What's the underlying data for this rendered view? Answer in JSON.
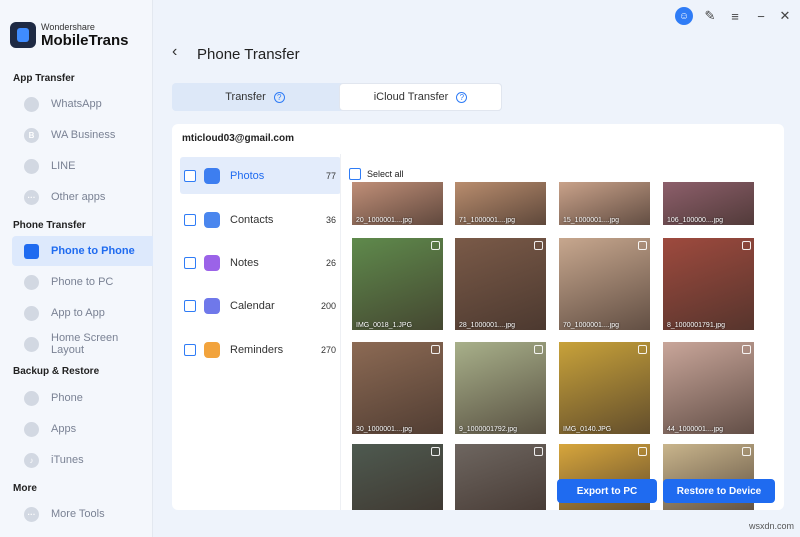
{
  "app": {
    "brand_small": "Wondershare",
    "brand_name": "MobileTrans"
  },
  "sidebar": {
    "sections": [
      {
        "title": "App Transfer",
        "items": [
          {
            "label": "WhatsApp",
            "icon": "whatsapp-icon"
          },
          {
            "label": "WA Business",
            "icon": "wa-business-icon"
          },
          {
            "label": "LINE",
            "icon": "line-icon"
          },
          {
            "label": "Other apps",
            "icon": "other-apps-icon"
          }
        ]
      },
      {
        "title": "Phone Transfer",
        "items": [
          {
            "label": "Phone to Phone",
            "icon": "phone-to-phone-icon",
            "active": true
          },
          {
            "label": "Phone to PC",
            "icon": "phone-to-pc-icon"
          },
          {
            "label": "App to App",
            "icon": "app-to-app-icon"
          },
          {
            "label": "Home Screen Layout",
            "icon": "home-screen-icon"
          }
        ]
      },
      {
        "title": "Backup & Restore",
        "items": [
          {
            "label": "Phone",
            "icon": "phone-icon"
          },
          {
            "label": "Apps",
            "icon": "apps-icon"
          },
          {
            "label": "iTunes",
            "icon": "itunes-icon"
          }
        ]
      },
      {
        "title": "More",
        "items": [
          {
            "label": "More Tools",
            "icon": "more-tools-icon"
          }
        ]
      }
    ]
  },
  "window": {
    "icons": [
      "account-icon",
      "feedback-icon",
      "menu-icon",
      "close-icon"
    ]
  },
  "header": {
    "back_icon": "back-arrow-icon",
    "title": "Phone Transfer"
  },
  "tabs": [
    {
      "label": "Transfer",
      "selected": false
    },
    {
      "label": "iCloud Transfer",
      "selected": true
    }
  ],
  "panel": {
    "account": "mticloud03@gmail.com",
    "categories": [
      {
        "label": "Photos",
        "count": "77",
        "color": "#3d7ef0",
        "active": true
      },
      {
        "label": "Contacts",
        "count": "36",
        "color": "#4a86ee"
      },
      {
        "label": "Notes",
        "count": "26",
        "color": "#9b63e8"
      },
      {
        "label": "Calendar",
        "count": "200",
        "color": "#6f78ea"
      },
      {
        "label": "Reminders",
        "count": "270",
        "color": "#f2a33c"
      }
    ],
    "select_all": "Select all",
    "photos": [
      {
        "caption": "20_1000001....jpg",
        "bg": "#c08f78"
      },
      {
        "caption": "71_1000001....jpg",
        "bg": "#b98d6e"
      },
      {
        "caption": "15_1000001....jpg",
        "bg": "#c9a28a"
      },
      {
        "caption": "106_100000....jpg",
        "bg": "#8d5f6b"
      },
      {
        "caption": "IMG_0018_1.JPG",
        "bg": "#5f8a4c"
      },
      {
        "caption": "28_1000001....jpg",
        "bg": "#7a5a48"
      },
      {
        "caption": "70_1000001....jpg",
        "bg": "#c7a78e"
      },
      {
        "caption": "8_1000001791.jpg",
        "bg": "#9e4a3e"
      },
      {
        "caption": "30_1000001....jpg",
        "bg": "#8c6a54"
      },
      {
        "caption": "9_1000001792.jpg",
        "bg": "#a8b08a"
      },
      {
        "caption": "IMG_0140.JPG",
        "bg": "#c8a23a"
      },
      {
        "caption": "44_1000001....jpg",
        "bg": "#c9a69a"
      },
      {
        "caption": "",
        "bg": "#4e5a50"
      },
      {
        "caption": "",
        "bg": "#6e6660"
      },
      {
        "caption": "",
        "bg": "#d7a63c"
      },
      {
        "caption": "",
        "bg": "#c9b58c"
      }
    ],
    "export_label": "Export to PC",
    "restore_label": "Restore to Device"
  },
  "watermark": "wsxdn.com"
}
